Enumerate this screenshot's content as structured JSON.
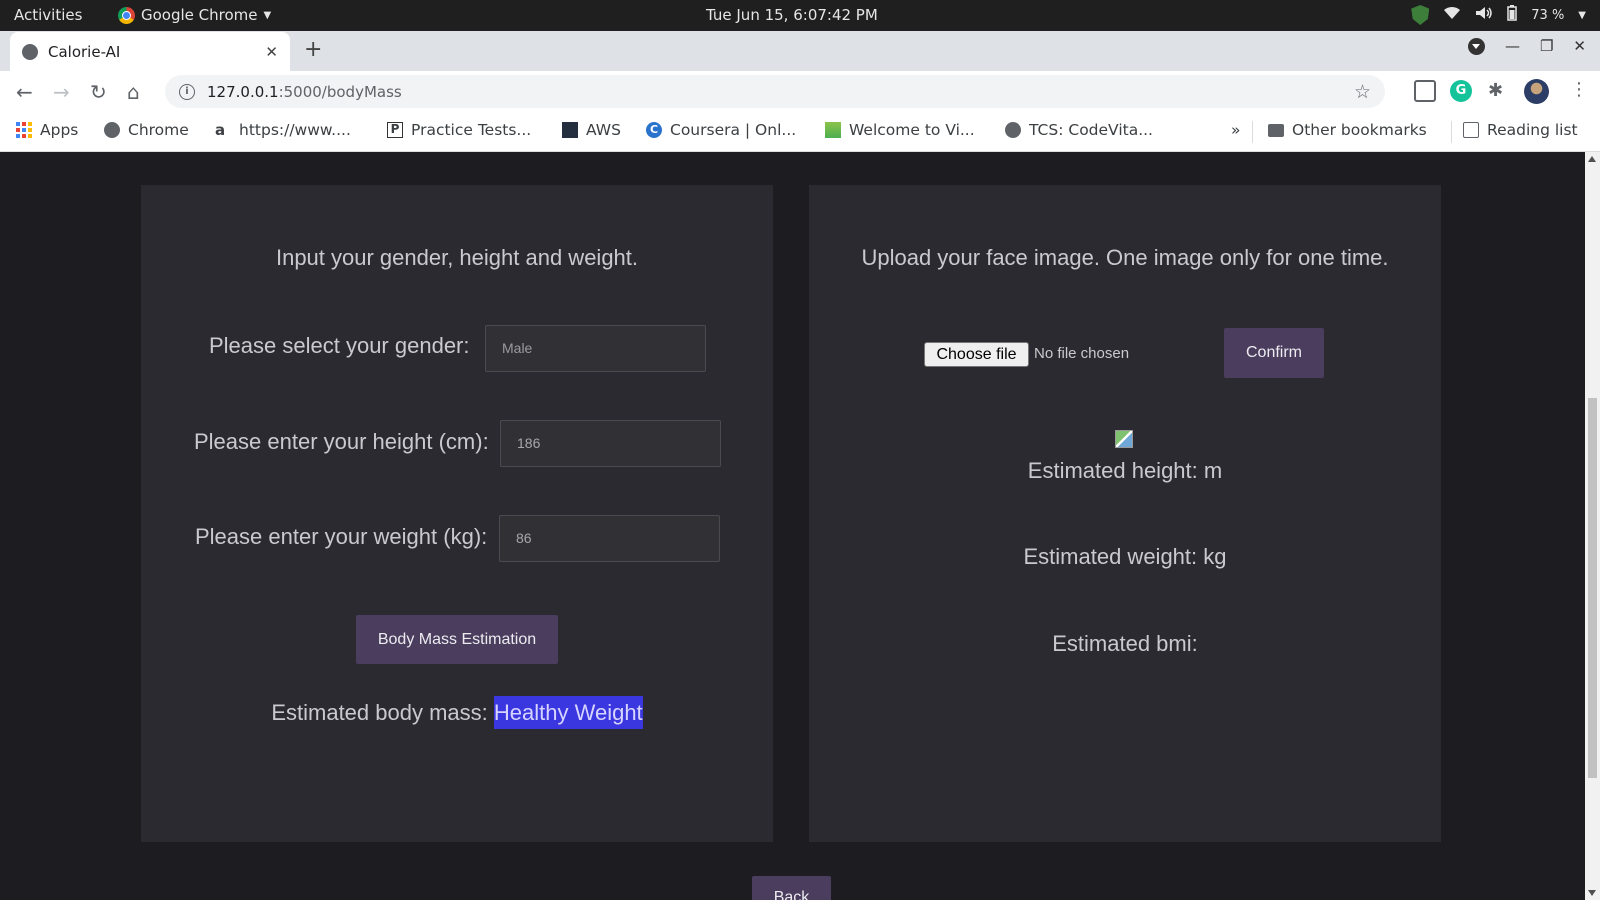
{
  "system": {
    "activities": "Activities",
    "app_name": "Google Chrome",
    "clock": "Tue Jun 15,  6:07:42 PM",
    "battery": "73 %"
  },
  "browser": {
    "tab_title": "Calorie-AI",
    "tab_close": "✕",
    "new_tab": "+",
    "url_host": "127.0.0.1",
    "url_path": ":5000/bodyMass",
    "bookmarks": [
      {
        "label": "Apps",
        "icon": "apps-grid-icon"
      },
      {
        "label": "Chrome",
        "icon": "globe-icon"
      },
      {
        "label": "https://www....",
        "icon": "amazon-icon"
      },
      {
        "label": "Practice Tests...",
        "icon": "practice-icon"
      },
      {
        "label": "AWS",
        "icon": "aws-icon"
      },
      {
        "label": "Coursera | Onl...",
        "icon": "coursera-icon"
      },
      {
        "label": "Welcome to Vi...",
        "icon": "vi-icon"
      },
      {
        "label": "TCS: CodeVita...",
        "icon": "globe-icon"
      }
    ],
    "overflow": "»",
    "other_bookmarks": "Other bookmarks",
    "reading_list": "Reading list"
  },
  "left_panel": {
    "heading": "Input your gender, height and weight.",
    "gender_label": "Please select your gender:",
    "gender_value": "Male",
    "height_label": "Please enter your height (cm):",
    "height_value": "186",
    "weight_label": "Please enter your weight (kg):",
    "weight_value": "86",
    "estimate_button": "Body Mass Estimation",
    "result_label": "Estimated body mass:",
    "result_value": "Healthy Weight"
  },
  "right_panel": {
    "heading": "Upload your face image. One image only for one time.",
    "choose_file": "Choose file",
    "no_file": "No file chosen",
    "confirm_button": "Confirm",
    "est_height": "Estimated height: m",
    "est_weight": "Estimated weight: kg",
    "est_bmi": "Estimated bmi:"
  },
  "back_button": "Back",
  "colors": {
    "page_bg": "#1d1d21",
    "panel_bg": "#2b2a30",
    "button_bg": "#4b3d5e",
    "highlight": "#3b37e0"
  }
}
